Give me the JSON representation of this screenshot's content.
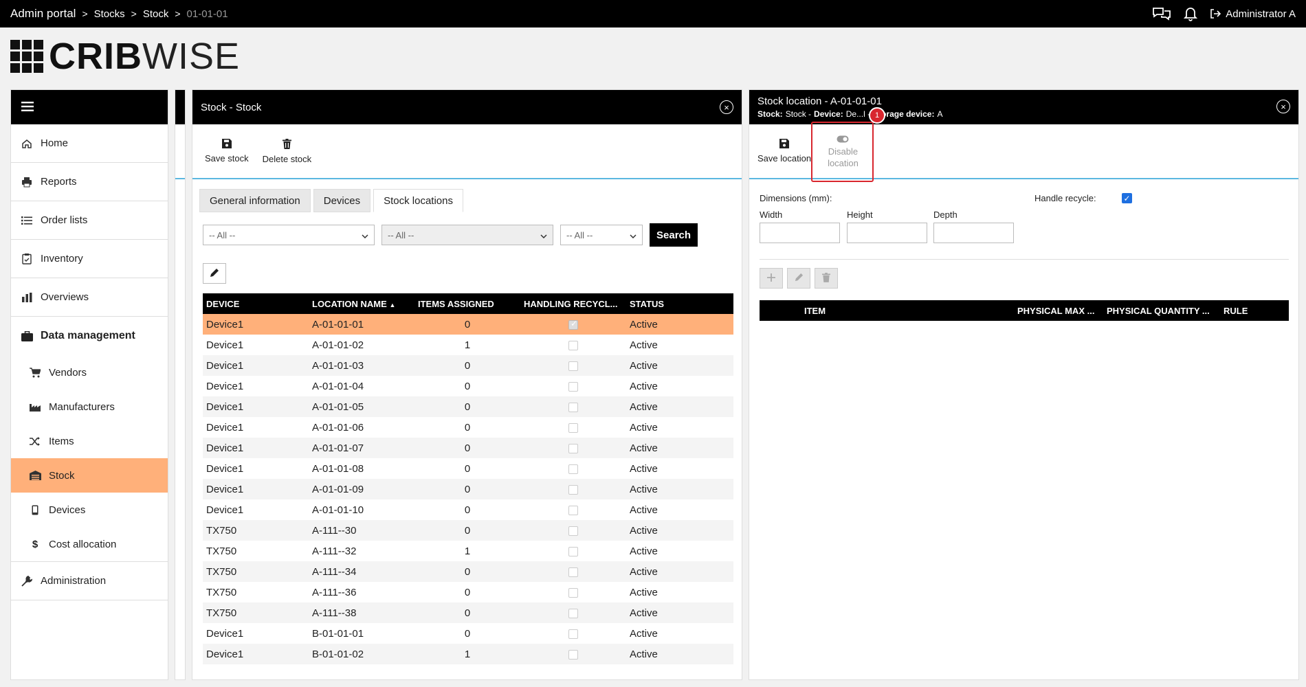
{
  "topbar": {
    "breadcrumbs": [
      "Admin portal",
      "Stocks",
      "Stock",
      "01-01-01"
    ],
    "separator": ">",
    "user": "Administrator A"
  },
  "logo": {
    "bold": "CRIB",
    "light": "WISE"
  },
  "sidebar": {
    "items": [
      {
        "label": "Home",
        "icon": "home-icon"
      },
      {
        "label": "Reports",
        "icon": "printer-icon"
      },
      {
        "label": "Order lists",
        "icon": "list-icon"
      },
      {
        "label": "Inventory",
        "icon": "clipboard-icon"
      },
      {
        "label": "Overviews",
        "icon": "bar-chart-icon"
      },
      {
        "label": "Data management",
        "icon": "briefcase-icon"
      },
      {
        "label": "Administration",
        "icon": "wrench-icon"
      }
    ],
    "sub_items": [
      {
        "label": "Vendors",
        "icon": "cart-icon"
      },
      {
        "label": "Manufacturers",
        "icon": "factory-icon"
      },
      {
        "label": "Items",
        "icon": "shuffle-icon"
      },
      {
        "label": "Stock",
        "icon": "warehouse-icon"
      },
      {
        "label": "Devices",
        "icon": "mobile-icon"
      },
      {
        "label": "Cost allocation",
        "icon": "dollar-icon"
      }
    ]
  },
  "stock_panel": {
    "title": "Stock - Stock",
    "save_label": "Save stock",
    "delete_label": "Delete stock",
    "tabs": [
      "General information",
      "Devices",
      "Stock locations"
    ],
    "filters": [
      "-- All --",
      "-- All --",
      "-- All --"
    ],
    "search_label": "Search",
    "columns": [
      "DEVICE",
      "LOCATION NAME",
      "ITEMS ASSIGNED",
      "HANDLING RECYCL...",
      "STATUS"
    ],
    "rows": [
      {
        "device": "Device1",
        "location": "A-01-01-01",
        "items": "0",
        "recycle": true,
        "status": "Active"
      },
      {
        "device": "Device1",
        "location": "A-01-01-02",
        "items": "1",
        "recycle": false,
        "status": "Active"
      },
      {
        "device": "Device1",
        "location": "A-01-01-03",
        "items": "0",
        "recycle": false,
        "status": "Active"
      },
      {
        "device": "Device1",
        "location": "A-01-01-04",
        "items": "0",
        "recycle": false,
        "status": "Active"
      },
      {
        "device": "Device1",
        "location": "A-01-01-05",
        "items": "0",
        "recycle": false,
        "status": "Active"
      },
      {
        "device": "Device1",
        "location": "A-01-01-06",
        "items": "0",
        "recycle": false,
        "status": "Active"
      },
      {
        "device": "Device1",
        "location": "A-01-01-07",
        "items": "0",
        "recycle": false,
        "status": "Active"
      },
      {
        "device": "Device1",
        "location": "A-01-01-08",
        "items": "0",
        "recycle": false,
        "status": "Active"
      },
      {
        "device": "Device1",
        "location": "A-01-01-09",
        "items": "0",
        "recycle": false,
        "status": "Active"
      },
      {
        "device": "Device1",
        "location": "A-01-01-10",
        "items": "0",
        "recycle": false,
        "status": "Active"
      },
      {
        "device": "TX750",
        "location": "A-111--30",
        "items": "0",
        "recycle": false,
        "status": "Active"
      },
      {
        "device": "TX750",
        "location": "A-111--32",
        "items": "1",
        "recycle": false,
        "status": "Active"
      },
      {
        "device": "TX750",
        "location": "A-111--34",
        "items": "0",
        "recycle": false,
        "status": "Active"
      },
      {
        "device": "TX750",
        "location": "A-111--36",
        "items": "0",
        "recycle": false,
        "status": "Active"
      },
      {
        "device": "TX750",
        "location": "A-111--38",
        "items": "0",
        "recycle": false,
        "status": "Active"
      },
      {
        "device": "Device1",
        "location": "B-01-01-01",
        "items": "0",
        "recycle": false,
        "status": "Active"
      },
      {
        "device": "Device1",
        "location": "B-01-01-02",
        "items": "1",
        "recycle": false,
        "status": "Active"
      }
    ]
  },
  "location_panel": {
    "title": "Stock location - A-01-01-01",
    "sub_stock_label": "Stock:",
    "sub_stock_value": "Stock -",
    "sub_device_label": "Device:",
    "sub_device_value": "De...l -",
    "sub_storage_label": "Storage device:",
    "sub_storage_value": "A",
    "save_label": "Save location",
    "disable_label_1": "Disable",
    "disable_label_2": "location",
    "badge": "1",
    "dimensions_label": "Dimensions (mm):",
    "width_label": "Width",
    "height_label": "Height",
    "depth_label": "Depth",
    "handle_recycle_label": "Handle recycle:",
    "handle_recycle": true,
    "columns": [
      "ITEM",
      "PHYSICAL MAX ...",
      "PHYSICAL QUANTITY ...",
      "RULE"
    ]
  }
}
